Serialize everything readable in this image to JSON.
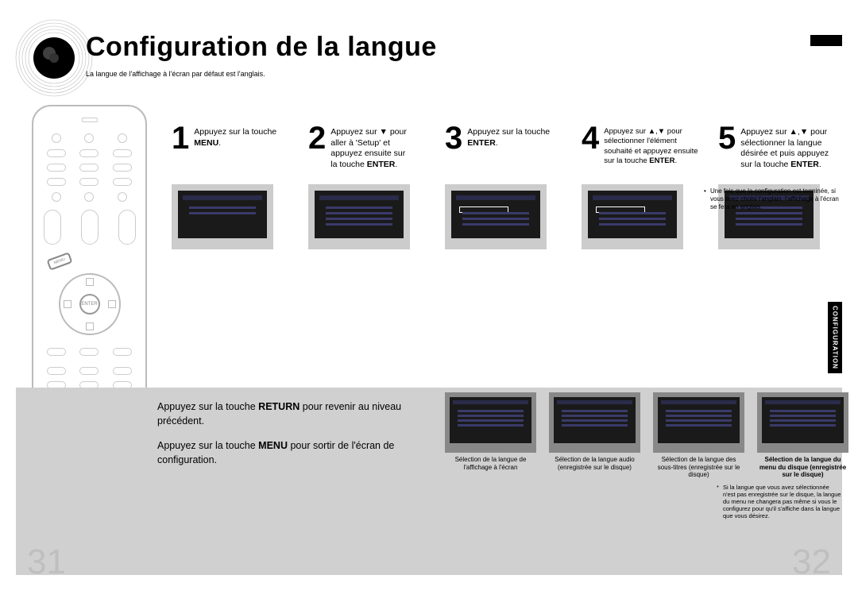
{
  "header": {
    "title": "Configuration de la langue",
    "subtitle": "La langue de l'affichage à l'écran par défaut est l'anglais."
  },
  "side_tab": "CONFIGURATION",
  "remote": {
    "enter_label": "ENTER",
    "menu_label": "MENU"
  },
  "steps": [
    {
      "num": "1",
      "text_pre": "Appuyez sur la touche ",
      "bold": "MENU",
      "text_post": "."
    },
    {
      "num": "2",
      "text_lines": [
        "Appuyez sur ▼ pour",
        "aller à 'Setup' et",
        "appuyez ensuite sur",
        "la touche "
      ],
      "bold_suffix": "ENTER",
      "suffix": "."
    },
    {
      "num": "3",
      "text_pre": "Appuyez sur la touche ",
      "bold": "ENTER",
      "text_post": "."
    },
    {
      "num": "4",
      "text_lines": [
        "Appuyez sur ▲,▼ pour",
        "sélectionner l'élément",
        "souhaité et appuyez ensuite",
        "sur la touche "
      ],
      "bold_suffix": "ENTER",
      "suffix": "."
    },
    {
      "num": "5",
      "text_lines": [
        "Appuyez sur ▲,▼ pour",
        "sélectionner la langue",
        "désirée et puis appuyez",
        "sur la touche "
      ],
      "bold_suffix": "ENTER",
      "suffix": "."
    }
  ],
  "bullet_note": "Une fois que la configuration est terminée, si vous avez choisi l'anglais, l'affichage à l'écran se fera en anglais.",
  "return_notes": {
    "line1_pre": "Appuyez sur la touche ",
    "line1_bold": "RETURN",
    "line1_post": " pour revenir au niveau précédent.",
    "line2_pre": "Appuyez sur la touche ",
    "line2_bold": "MENU",
    "line2_post": " pour sortir de l'écran de configuration."
  },
  "lower_thumbs": [
    {
      "caption": "Sélection de la langue de l'affichage à l'écran"
    },
    {
      "caption": "Sélection de la langue audio (enregistrée sur le disque)"
    },
    {
      "caption": "Sélection de la langue des sous-titres (enregistrée sur le disque)"
    },
    {
      "caption": "Sélection de la langue du menu du disque (enregistrée sur le disque)"
    }
  ],
  "asterisk_note": "Si la langue que vous avez sélectionnée n'est pas enregistrée sur le disque, la langue du menu ne changera pas même si vous le configurez pour qu'il s'affiche dans la langue que vous désirez.",
  "page_numbers": {
    "left": "31",
    "right": "32"
  }
}
